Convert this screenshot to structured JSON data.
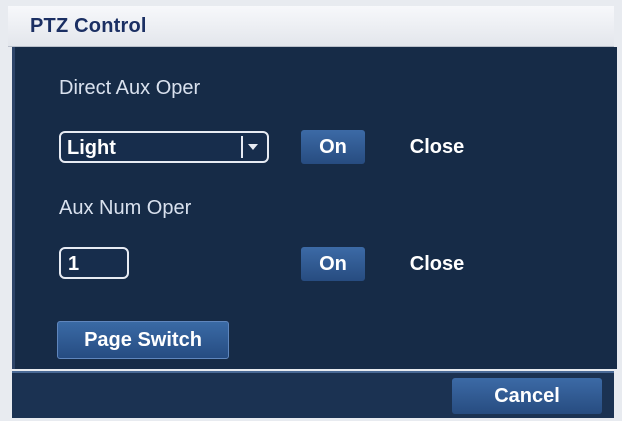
{
  "window": {
    "title": "PTZ Control"
  },
  "direct_aux": {
    "label": "Direct Aux Oper",
    "select_value": "Light",
    "on_label": "On",
    "close_label": "Close"
  },
  "aux_num": {
    "label": "Aux Num Oper",
    "input_value": "1",
    "on_label": "On",
    "close_label": "Close"
  },
  "page_switch_label": "Page Switch",
  "footer": {
    "cancel_label": "Cancel"
  },
  "colors": {
    "panel": "#162b47",
    "button": "#2f5a93",
    "title_text": "#1b2f63"
  },
  "icons": {
    "dropdown": "chevron-down-icon"
  }
}
